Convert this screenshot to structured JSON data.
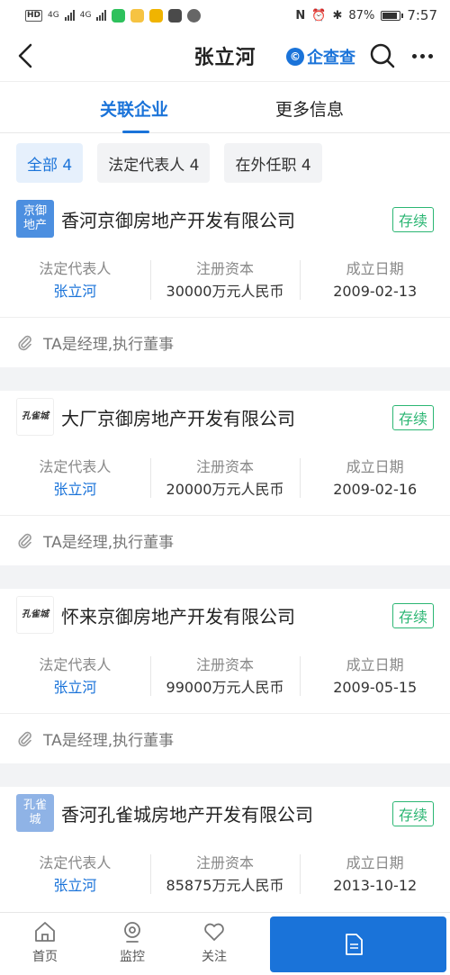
{
  "status_bar": {
    "left_chip": "HD",
    "net1": "4G",
    "net2": "4G",
    "battery_text": "87%",
    "time": "7:57"
  },
  "nav": {
    "title": "张立河",
    "brand": "企查查",
    "brand_color": "#1a73d9"
  },
  "tabs": [
    {
      "label": "关联企业",
      "active": true
    },
    {
      "label": "更多信息",
      "active": false
    }
  ],
  "filters": [
    {
      "label": "全部 4",
      "active": true
    },
    {
      "label": "法定代表人 4",
      "active": false
    },
    {
      "label": "在外任职 4",
      "active": false
    }
  ],
  "columns": {
    "rep": "法定代表人",
    "capital": "注册资本",
    "date": "成立日期"
  },
  "cards": [
    {
      "logo": "京御\n地产",
      "logo_style": "blue",
      "name": "香河京御房地产开发有限公司",
      "status": "存续",
      "rep": "张立河",
      "capital": "30000万元人民币",
      "date": "2009-02-13",
      "role": "TA是经理,执行董事"
    },
    {
      "logo": "孔雀城",
      "logo_style": "img",
      "name": "大厂京御房地产开发有限公司",
      "status": "存续",
      "rep": "张立河",
      "capital": "20000万元人民币",
      "date": "2009-02-16",
      "role": "TA是经理,执行董事"
    },
    {
      "logo": "孔雀城",
      "logo_style": "img",
      "name": "怀来京御房地产开发有限公司",
      "status": "存续",
      "rep": "张立河",
      "capital": "99000万元人民币",
      "date": "2009-05-15",
      "role": "TA是经理,执行董事"
    },
    {
      "logo": "孔雀\n城",
      "logo_style": "lightblue",
      "name": "香河孔雀城房地产开发有限公司",
      "status": "存续",
      "rep": "张立河",
      "capital": "85875万元人民币",
      "date": "2013-10-12",
      "role": ""
    }
  ],
  "bottom_nav": [
    {
      "label": "首页",
      "icon": "home-icon"
    },
    {
      "label": "监控",
      "icon": "camera-icon"
    },
    {
      "label": "关注",
      "icon": "heart-icon"
    }
  ],
  "report_button": {
    "label": "",
    "icon": "document-icon"
  }
}
